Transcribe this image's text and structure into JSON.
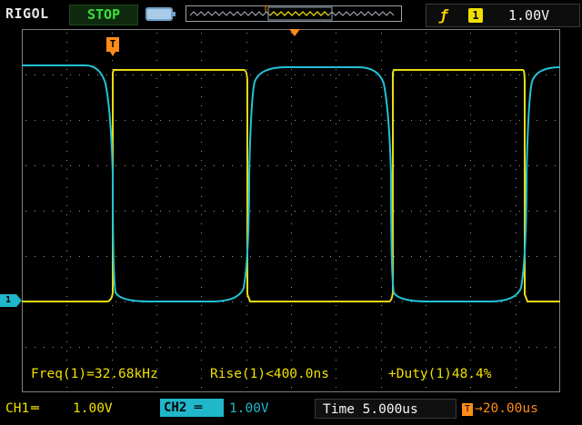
{
  "header": {
    "brand": "RIGOL",
    "run_status": "STOP",
    "trigger_marker": "T",
    "trigger_channel": "1",
    "trigger_level": "1.00V"
  },
  "screen": {
    "trigger_marker": "T",
    "ground_marker": "1"
  },
  "measurements": {
    "freq": "Freq(1)=32.68kHz",
    "rise": "Rise(1)<400.0ns",
    "duty": "+Duty(1)48.4%"
  },
  "footer": {
    "ch1_label": "CH1",
    "ch1_scale": "1.00V",
    "ch2_label": "CH2",
    "ch2_scale": "1.00V",
    "timebase": "Time 5.000us",
    "trigger_delay": "20.00us",
    "trigger_delay_marker": "T"
  },
  "colors": {
    "ch1": "#f0e000",
    "ch2": "#1fb7c9",
    "trigger": "#ff8c1a",
    "grid": "#8a8a8a"
  }
}
